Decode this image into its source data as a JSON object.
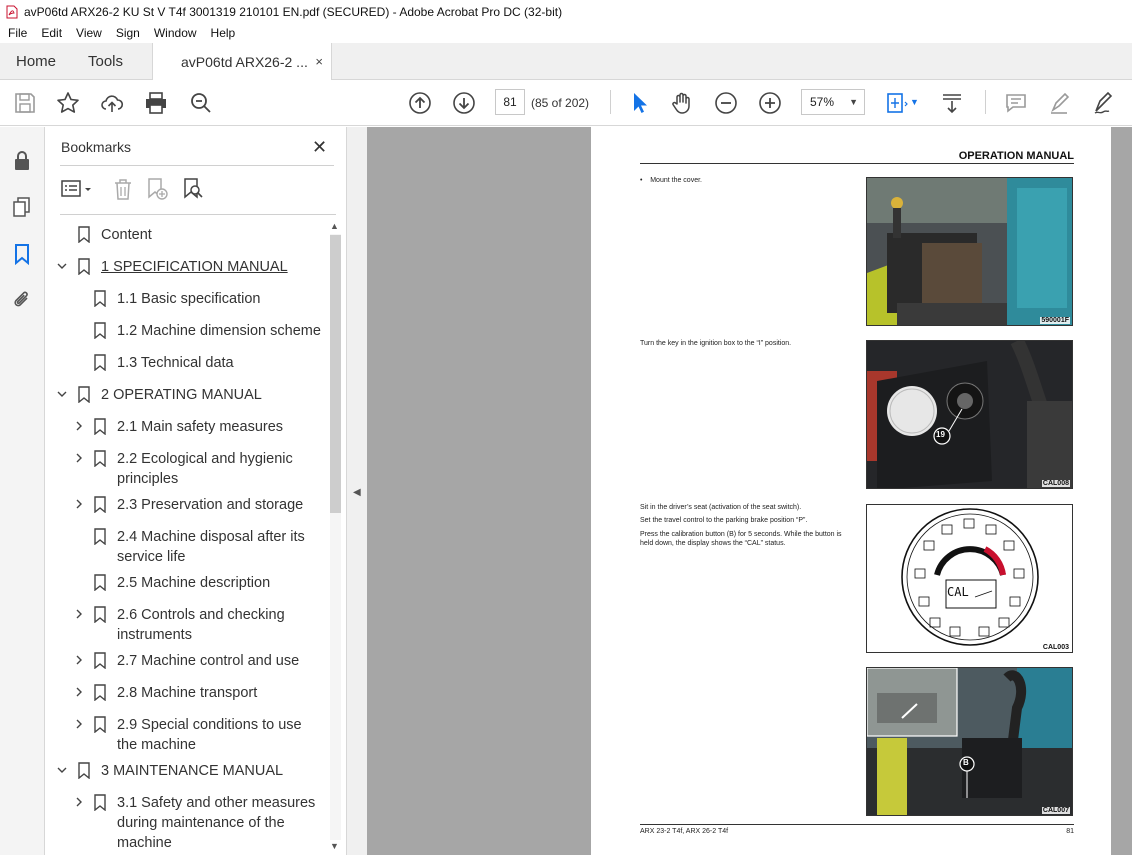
{
  "window": {
    "title": "avP06td ARX26-2 KU St V T4f 3001319 210101 EN.pdf (SECURED) - Adobe Acrobat Pro DC (32-bit)"
  },
  "menu": [
    "File",
    "Edit",
    "View",
    "Sign",
    "Window",
    "Help"
  ],
  "tabs": {
    "home": "Home",
    "tools": "Tools",
    "document": "avP06td ARX26-2 ...",
    "close": "×"
  },
  "toolbar": {
    "page_number": "81",
    "page_of": "(85 of 202)",
    "zoom": "57%"
  },
  "bookmarks": {
    "title": "Bookmarks",
    "close": "✕",
    "items": [
      {
        "label": "Content",
        "level": 0,
        "expander": "none"
      },
      {
        "label": "1 SPECIFICATION MANUAL",
        "level": 0,
        "expander": "open",
        "underlined": true
      },
      {
        "label": "1.1 Basic specification",
        "level": 1,
        "expander": "none"
      },
      {
        "label": "1.2 Machine dimension scheme",
        "level": 1,
        "expander": "none"
      },
      {
        "label": "1.3 Technical data",
        "level": 1,
        "expander": "none"
      },
      {
        "label": "2 OPERATING MANUAL",
        "level": 0,
        "expander": "open"
      },
      {
        "label": "2.1 Main safety measures",
        "level": 1,
        "expander": "closed"
      },
      {
        "label": "2.2 Ecological and hygienic principles",
        "level": 1,
        "expander": "closed"
      },
      {
        "label": "2.3 Preservation and storage",
        "level": 1,
        "expander": "closed"
      },
      {
        "label": "2.4 Machine disposal after its service life",
        "level": 1,
        "expander": "none"
      },
      {
        "label": "2.5 Machine description",
        "level": 1,
        "expander": "none"
      },
      {
        "label": "2.6 Controls and checking instruments",
        "level": 1,
        "expander": "closed"
      },
      {
        "label": "2.7 Machine control and use",
        "level": 1,
        "expander": "closed"
      },
      {
        "label": "2.8 Machine transport",
        "level": 1,
        "expander": "closed"
      },
      {
        "label": "2.9 Special conditions to use the machine",
        "level": 1,
        "expander": "closed"
      },
      {
        "label": "3 MAINTENANCE MANUAL",
        "level": 0,
        "expander": "open"
      },
      {
        "label": "3.1 Safety and other measures during maintenance of the machine",
        "level": 1,
        "expander": "closed"
      }
    ]
  },
  "document_page": {
    "header": "OPERATION MANUAL",
    "steps": [
      "•    Mount the cover.",
      "Turn the key in the ignition box to the “I” position.",
      "Sit in the driver’s seat (activation of the seat switch).",
      "Set the travel control to the parking brake position “P”.",
      "Press the calibration button (B) for 5 seconds. While the button is held down, the display shows the “CAL” status."
    ],
    "figures": [
      "590001F",
      "CAL008",
      "CAL003",
      "CAL007"
    ],
    "callouts": [
      "19",
      "B"
    ],
    "display_text": "CAL",
    "footer_left": "ARX 23-2 T4f, ARX 26-2 T4f",
    "footer_right": "81"
  },
  "colors": {
    "viewer_bg": "#a6a6a6",
    "acrobat_red": "#c8102e",
    "accent_blue": "#1473e6"
  }
}
